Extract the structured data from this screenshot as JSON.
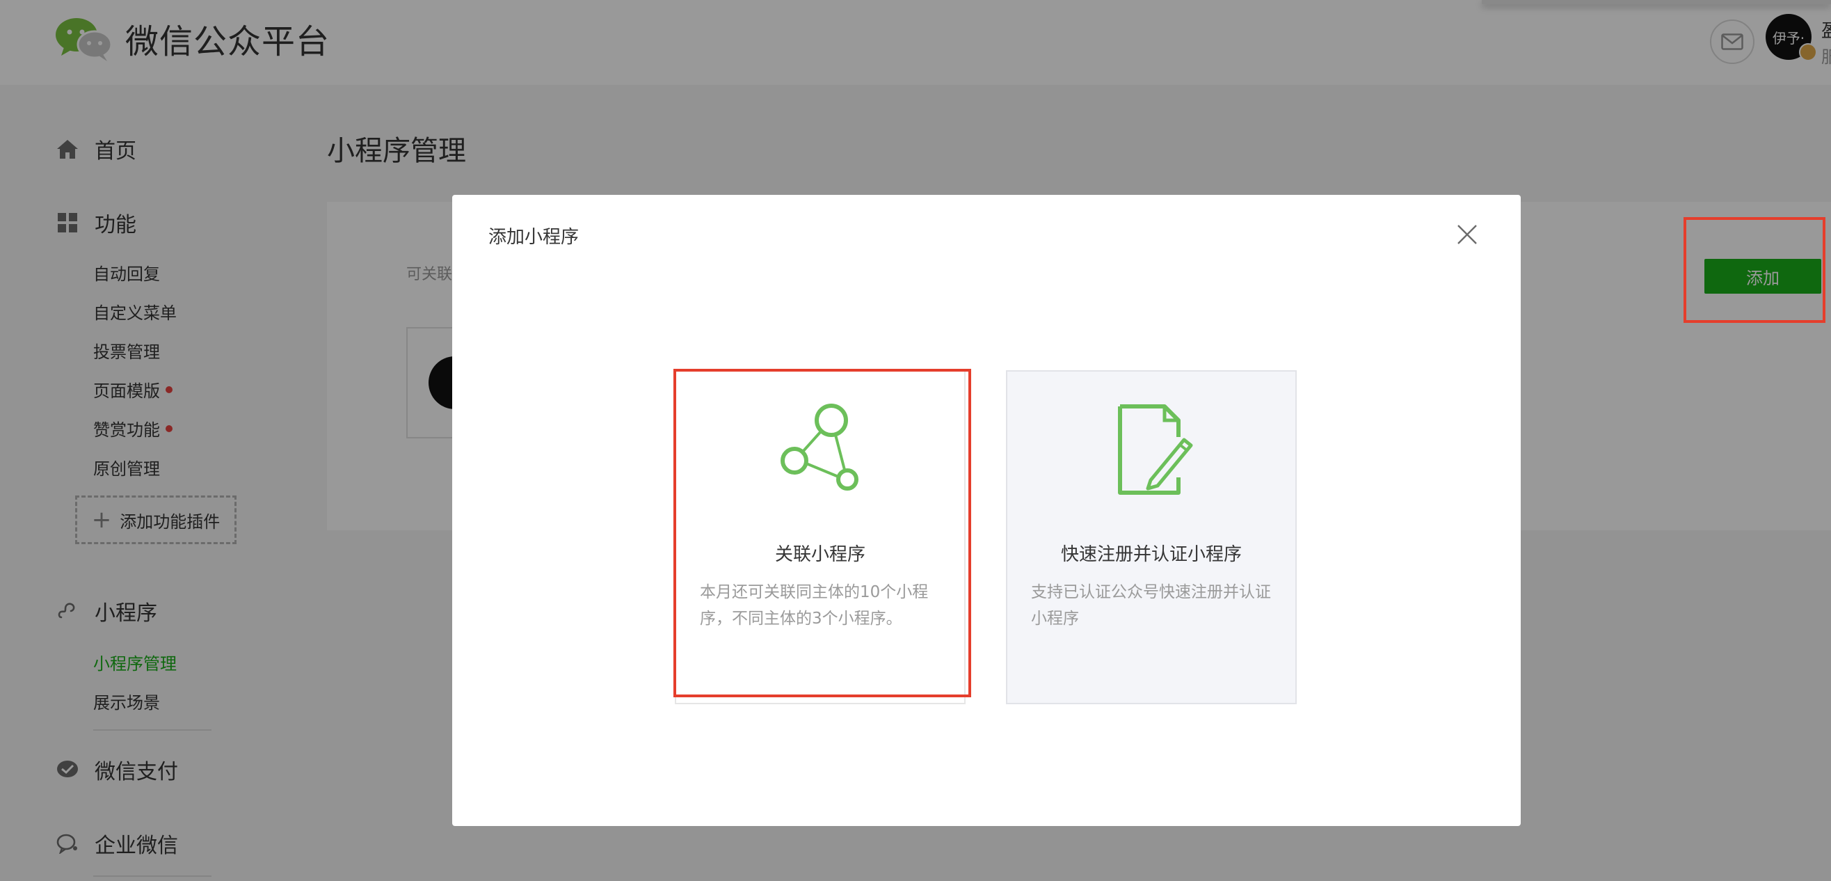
{
  "header": {
    "logo_text": "微信公众平台",
    "user_name": "盈",
    "user_sub": "服",
    "avatar_text": "伊予·"
  },
  "sidebar": {
    "home": "首页",
    "functions": {
      "label": "功能",
      "items": [
        {
          "label": "自动回复",
          "dot": false
        },
        {
          "label": "自定义菜单",
          "dot": false
        },
        {
          "label": "投票管理",
          "dot": false
        },
        {
          "label": "页面模版",
          "dot": true
        },
        {
          "label": "赞赏功能",
          "dot": true
        },
        {
          "label": "原创管理",
          "dot": false
        }
      ],
      "add_plugin": "添加功能插件"
    },
    "mini_program": {
      "label": "小程序",
      "items": [
        {
          "label": "小程序管理",
          "active": true
        },
        {
          "label": "展示场景",
          "active": false
        }
      ]
    },
    "wechat_pay": "微信支付",
    "enterprise_wechat": "企业微信"
  },
  "main": {
    "title": "小程序管理",
    "desc_partial": "可关联",
    "add_button": "添加"
  },
  "modal": {
    "title": "添加小程序",
    "options": [
      {
        "title": "关联小程序",
        "desc": "本月还可关联同主体的10个小程序，不同主体的3个小程序。",
        "icon": "network-nodes-icon"
      },
      {
        "title": "快速注册并认证小程序",
        "desc": "支持已认证公众号快速注册并认证小程序",
        "icon": "document-pen-icon"
      }
    ]
  },
  "colors": {
    "brand_green": "#1aad19",
    "highlight_red": "#e53e2c",
    "icon_green": "#6cbf5a"
  }
}
